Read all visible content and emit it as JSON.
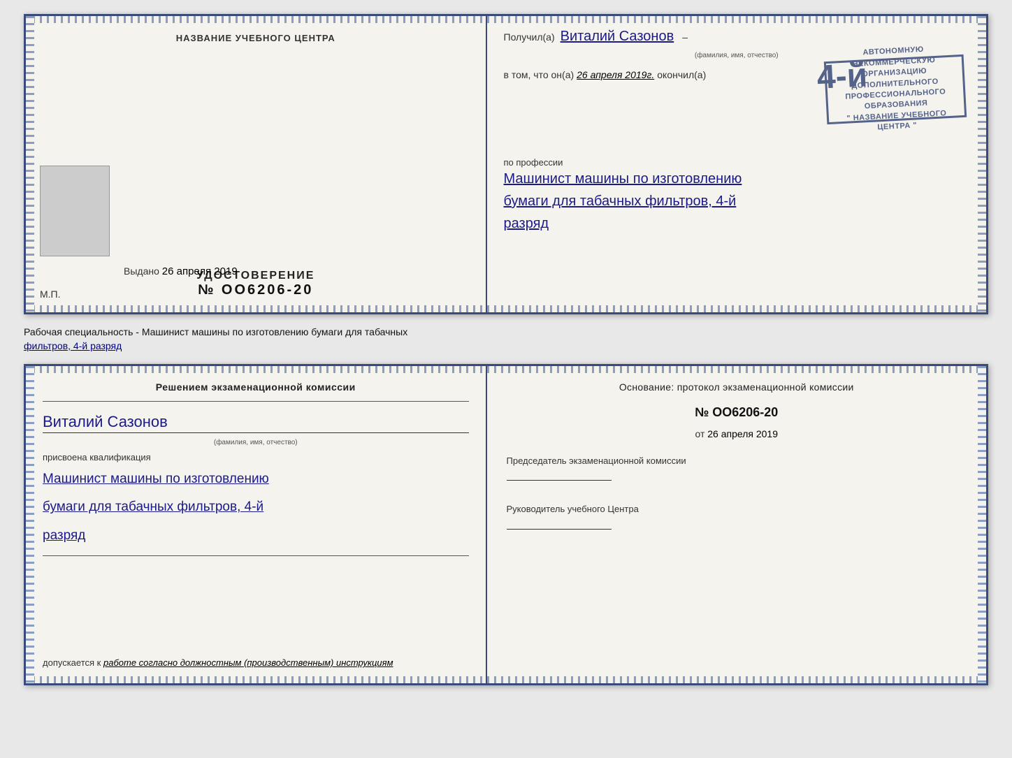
{
  "top_doc": {
    "left": {
      "center_title": "НАЗВАНИЕ УЧЕБНОГО ЦЕНТРА",
      "udostoverenie_label": "УДОСТОВЕРЕНИЕ",
      "udostoverenie_number": "№ OO6206-20",
      "vydano_label": "Выдано",
      "vydano_date": "26 апреля 2019",
      "mp_label": "М.П."
    },
    "right": {
      "poluchil_prefix": "Получил(а)",
      "poluchil_name": "Виталий Сазонов",
      "poluchil_hint": "(фамилия, имя, отчество)",
      "vtom_prefix": "в том, что он(а)",
      "vtom_date": "26 апреля 2019г.",
      "okончил": "окончил(а)",
      "stamp_line1": "АВТОНОМНУЮ НЕКОММЕРЧЕСКУЮ ОРГАНИЗАЦИЮ",
      "stamp_line2": "ДОПОЛНИТЕЛЬНОГО ПРОФЕССИОНАЛЬНОГО ОБРАЗОВАНИЯ",
      "stamp_line3": "\" НАЗВАНИЕ УЧЕБНОГО ЦЕНТРА \"",
      "stamp_number": "4-й",
      "professiya_label": "по профессии",
      "professiya_1": "Машинист машины по изготовлению",
      "professiya_2": "бумаги для табачных фильтров, 4-й",
      "professiya_3": "разряд"
    }
  },
  "separator": {
    "text_normal": "Рабочая специальность - Машинист машины по изготовлению бумаги для табачных",
    "text_underline": "фильтров, 4-й разряд"
  },
  "bottom_doc": {
    "left": {
      "komissia_title": "Решением  экзаменационной  комиссии",
      "name": "Виталий Сазонов",
      "name_hint": "(фамилия, имя, отчество)",
      "prisvoena": "присвоена квалификация",
      "kval_1": "Машинист машины по изготовлению",
      "kval_2": "бумаги для табачных фильтров, 4-й",
      "kval_3": "разряд",
      "dopuskaetsya_prefix": "допускается к",
      "dopuskaetsya_value": "работе согласно должностным (производственным) инструкциям"
    },
    "right": {
      "osnovanie": "Основание: протокол экзаменационной  комиссии",
      "protocol_number": "№  OO6206-20",
      "ot_prefix": "от",
      "ot_date": "26 апреля 2019",
      "predsedatel_label": "Председатель экзаменационной комиссии",
      "rukovoditel_label": "Руководитель учебного Центра"
    }
  }
}
